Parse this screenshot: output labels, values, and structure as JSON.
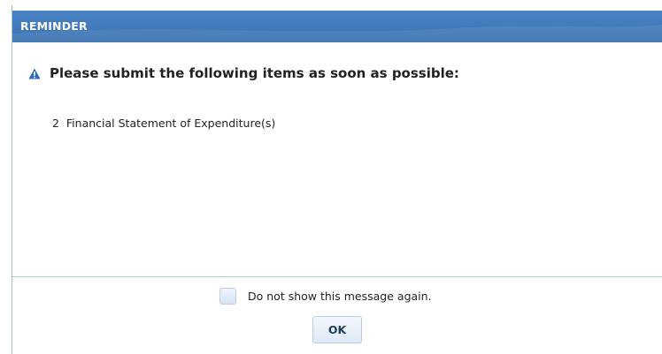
{
  "dialog": {
    "title": "REMINDER",
    "heading": "Please submit the following items as soon as possible:",
    "items": [
      "2  Financial Statement of Expenditure(s)"
    ],
    "checkbox_label": "Do not show this message again.",
    "checkbox_checked": false,
    "ok_label": "OK"
  },
  "icons": {
    "warning": "warning-triangle-icon"
  },
  "colors": {
    "titlebar": "#3a71b1",
    "warning_icon": "#2f6db5",
    "divider": "#a9c4e0"
  }
}
